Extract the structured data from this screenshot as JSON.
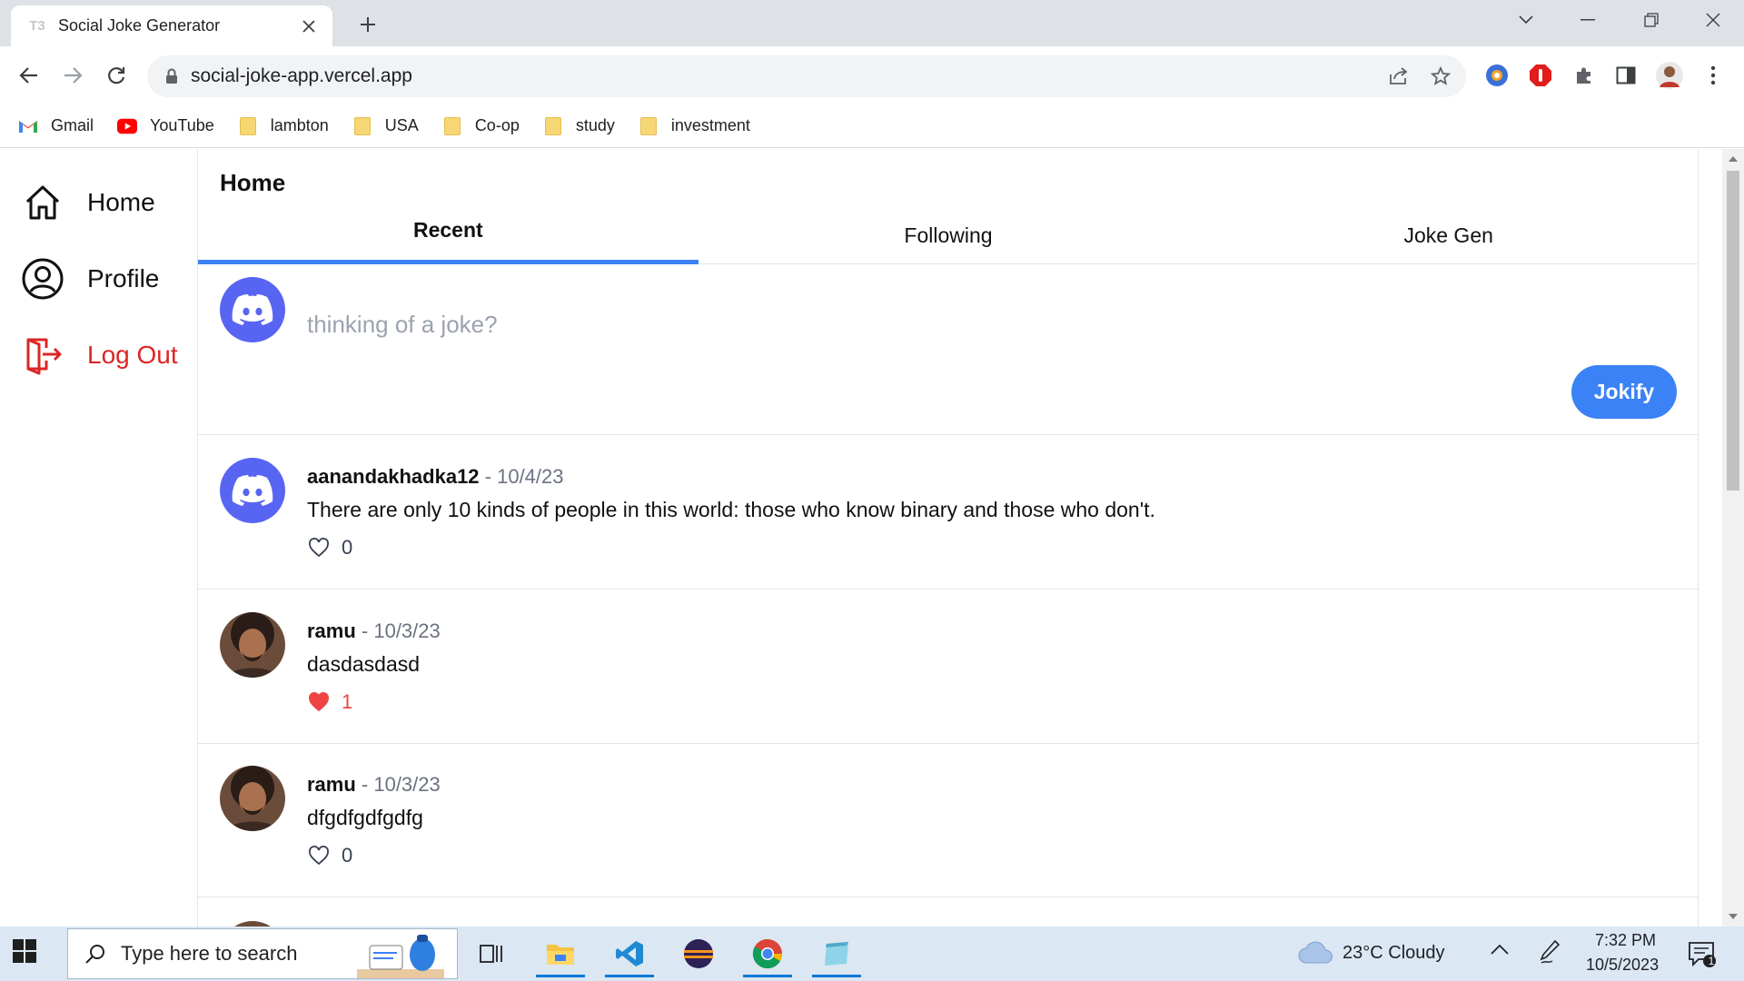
{
  "browser": {
    "tab_title": "Social Joke Generator",
    "tab_favicon": "T3",
    "url": "social-joke-app.vercel.app",
    "bookmarks": [
      {
        "label": "Gmail",
        "icon": "gmail-icon"
      },
      {
        "label": "YouTube",
        "icon": "youtube-icon"
      },
      {
        "label": "lambton",
        "icon": "folder-icon"
      },
      {
        "label": "USA",
        "icon": "folder-icon"
      },
      {
        "label": "Co-op",
        "icon": "folder-icon"
      },
      {
        "label": "study",
        "icon": "folder-icon"
      },
      {
        "label": "investment",
        "icon": "folder-icon"
      }
    ]
  },
  "sidebar": {
    "items": [
      {
        "label": "Home",
        "icon": "home-icon",
        "color": "#111111"
      },
      {
        "label": "Profile",
        "icon": "user-circle-icon",
        "color": "#111111"
      },
      {
        "label": "Log Out",
        "icon": "logout-icon",
        "color": "#dc2626"
      }
    ]
  },
  "main": {
    "title": "Home",
    "tabs": [
      {
        "label": "Recent",
        "active": true
      },
      {
        "label": "Following",
        "active": false
      },
      {
        "label": "Joke Gen",
        "active": false
      }
    ],
    "composer": {
      "placeholder": "thinking of a joke?",
      "value": "",
      "button_label": "Jokify",
      "avatar": "discord-avatar"
    },
    "posts": [
      {
        "username": "aanandakhadka12",
        "date": " - 10/4/23",
        "text": "There are only 10 kinds of people in this world: those who know binary and those who don't.",
        "likes": "0",
        "liked": false,
        "avatar": "discord-avatar"
      },
      {
        "username": "ramu",
        "date": " - 10/3/23",
        "text": "dasdasdasd",
        "likes": "1",
        "liked": true,
        "avatar": "photo-avatar"
      },
      {
        "username": "ramu",
        "date": " - 10/3/23",
        "text": "dfgdfgdfgdfg",
        "likes": "0",
        "liked": false,
        "avatar": "photo-avatar"
      }
    ]
  },
  "taskbar": {
    "search_placeholder": "Type here to search",
    "weather": "23°C  Cloudy",
    "time": "7:32 PM",
    "date": "10/5/2023",
    "notifications": "1"
  },
  "colors": {
    "accent": "#3b82f6",
    "discord": "#5865f2",
    "danger": "#dc2626",
    "liked": "#ef4444"
  }
}
